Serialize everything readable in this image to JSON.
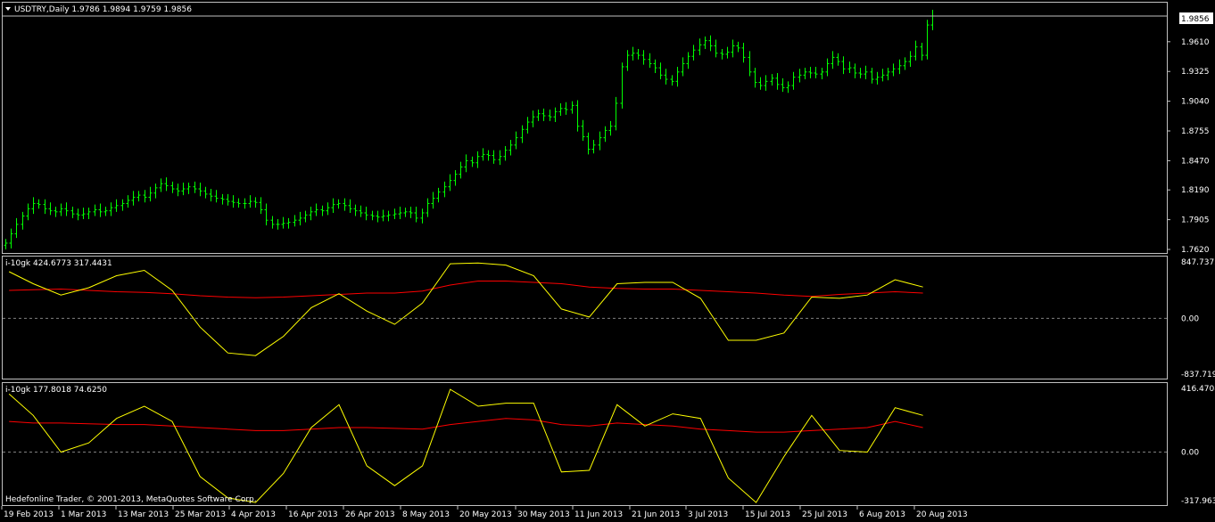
{
  "colors": {
    "background": "#000000",
    "frame": "#c0c0c0",
    "bar": "#00ff00",
    "osc_main": "#ffff00",
    "osc_signal": "#ff0000",
    "text": "#ffffff",
    "price_box_bg": "#ffffff",
    "price_box_text": "#000000"
  },
  "main": {
    "title": "USDTRY,Daily  1.9786 1.9894 1.9759 1.9856",
    "current_price": "1.9856"
  },
  "panel1": {
    "label": "i-10gk 424.6773 317.4431"
  },
  "panel2": {
    "label": "i-10gk 177.8018 74.6250"
  },
  "copyright": "Hedefonline Trader, © 2001-2013, MetaQuotes Software Corp.",
  "x_ticks": [
    "19 Feb 2013",
    "1 Mar 2013",
    "13 Mar 2013",
    "25 Mar 2013",
    "4 Apr 2013",
    "16 Apr 2013",
    "26 Apr 2013",
    "8 May 2013",
    "20 May 2013",
    "30 May 2013",
    "11 Jun 2013",
    "21 Jun 2013",
    "3 Jul 2013",
    "15 Jul 2013",
    "25 Jul 2013",
    "6 Aug 2013",
    "20 Aug 2013"
  ],
  "chart_data": [
    {
      "type": "ohlc",
      "title": "USDTRY,Daily",
      "ylim": [
        1.762,
        1.9856
      ],
      "y_ticks": [
        "1.9610",
        "1.9325",
        "1.9040",
        "1.8755",
        "1.8470",
        "1.8190",
        "1.7905",
        "1.7620"
      ],
      "close": [
        1.768,
        1.777,
        1.786,
        1.794,
        1.801,
        1.806,
        1.805,
        1.801,
        1.799,
        1.798,
        1.801,
        1.799,
        1.796,
        1.795,
        1.796,
        1.798,
        1.8,
        1.798,
        1.799,
        1.802,
        1.804,
        1.806,
        1.809,
        1.812,
        1.814,
        1.812,
        1.816,
        1.821,
        1.825,
        1.823,
        1.82,
        1.818,
        1.82,
        1.822,
        1.82,
        1.818,
        1.815,
        1.813,
        1.811,
        1.81,
        1.808,
        1.807,
        1.806,
        1.806,
        1.808,
        1.807,
        1.8,
        1.79,
        1.786,
        1.786,
        1.787,
        1.788,
        1.79,
        1.792,
        1.795,
        1.798,
        1.8,
        1.799,
        1.802,
        1.805,
        1.806,
        1.804,
        1.801,
        1.799,
        1.797,
        1.795,
        1.794,
        1.793,
        1.794,
        1.795,
        1.796,
        1.797,
        1.798,
        1.797,
        1.792,
        1.797,
        1.806,
        1.811,
        1.817,
        1.822,
        1.828,
        1.834,
        1.841,
        1.847,
        1.845,
        1.851,
        1.853,
        1.852,
        1.848,
        1.851,
        1.857,
        1.862,
        1.869,
        1.877,
        1.884,
        1.889,
        1.892,
        1.89,
        1.889,
        1.894,
        1.897,
        1.896,
        1.9,
        1.88,
        1.87,
        1.858,
        1.862,
        1.869,
        1.876,
        1.88,
        1.902,
        1.937,
        1.948,
        1.95,
        1.948,
        1.944,
        1.94,
        1.936,
        1.929,
        1.925,
        1.923,
        1.932,
        1.94,
        1.947,
        1.953,
        1.958,
        1.962,
        1.957,
        1.95,
        1.949,
        1.951,
        1.957,
        1.955,
        1.946,
        1.932,
        1.922,
        1.919,
        1.923,
        1.926,
        1.92,
        1.917,
        1.919,
        1.927,
        1.929,
        1.932,
        1.931,
        1.93,
        1.932,
        1.94,
        1.946,
        1.942,
        1.935,
        1.936,
        1.931,
        1.93,
        1.932,
        1.925,
        1.927,
        1.929,
        1.932,
        1.935,
        1.938,
        1.942,
        1.947,
        1.956,
        1.948,
        1.977,
        1.9856
      ],
      "axis_frac_pos": [
        0,
        0.108,
        0.229,
        0.358,
        0.502,
        0.646,
        0.789,
        0.929
      ],
      "osc_panels": [
        {
          "ylim": [
            -837.719,
            847.7373
          ],
          "y_ticks": [
            "847.7373",
            "0.00",
            "-837.719"
          ],
          "x_pos": [
            0.004,
            0.03,
            0.06,
            0.09,
            0.12,
            0.15,
            0.18,
            0.21,
            0.24,
            0.27,
            0.3,
            0.33,
            0.36,
            0.39,
            0.42,
            0.45,
            0.48,
            0.51,
            0.54,
            0.57,
            0.6,
            0.63,
            0.66,
            0.69,
            0.72,
            0.75,
            0.78,
            0.81,
            0.84,
            0.87,
            0.9,
            0.93,
            0.96,
            0.99
          ],
          "main": [
            700,
            520,
            350,
            460,
            640,
            720,
            420,
            -130,
            -520,
            -560,
            -270,
            160,
            370,
            110,
            -90,
            230,
            820,
            830,
            800,
            640,
            140,
            20,
            520,
            540,
            540,
            300,
            -330,
            -330,
            -220,
            320,
            300,
            350,
            580,
            470
          ],
          "signal": [
            420,
            430,
            440,
            420,
            400,
            390,
            370,
            340,
            320,
            310,
            320,
            340,
            360,
            380,
            380,
            410,
            500,
            560,
            560,
            540,
            520,
            470,
            450,
            440,
            440,
            420,
            400,
            380,
            350,
            330,
            360,
            380,
            400,
            380
          ]
        },
        {
          "ylim": [
            -317.963,
            416.4708
          ],
          "y_ticks": [
            "416.4708",
            "0.00",
            "-317.963"
          ],
          "main": [
            380,
            240,
            0,
            60,
            220,
            300,
            200,
            -160,
            -300,
            -330,
            -140,
            160,
            310,
            -90,
            -220,
            -90,
            410,
            300,
            320,
            320,
            -130,
            -120,
            310,
            170,
            250,
            220,
            -170,
            -330,
            -30,
            240,
            10,
            0,
            290,
            240
          ],
          "signal": [
            200,
            190,
            190,
            185,
            180,
            180,
            170,
            160,
            150,
            140,
            140,
            150,
            160,
            160,
            155,
            150,
            180,
            200,
            220,
            210,
            180,
            170,
            190,
            180,
            170,
            150,
            140,
            130,
            130,
            140,
            150,
            160,
            200,
            160
          ]
        }
      ]
    }
  ]
}
